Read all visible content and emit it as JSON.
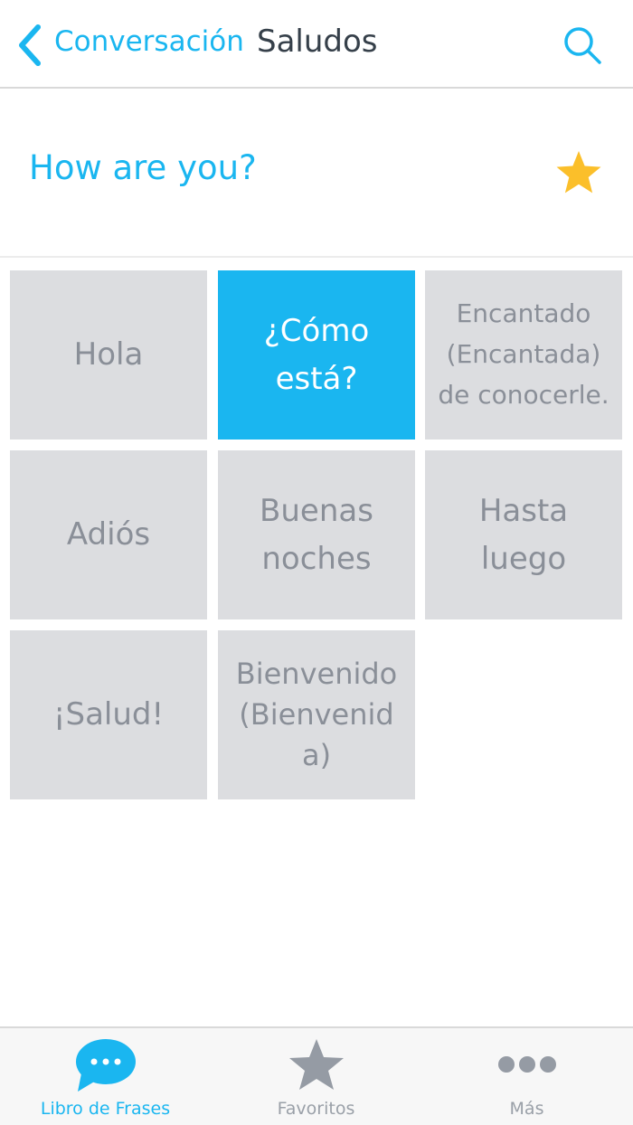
{
  "nav": {
    "back_label": "Conversación",
    "title": "Saludos"
  },
  "phrase": {
    "text": "How are you?",
    "favorited": true
  },
  "tiles": [
    {
      "label": "Hola",
      "selected": false
    },
    {
      "label": "¿Cómo\nestá?",
      "selected": true
    },
    {
      "label": "Encantado\n(Encantada)\nde conocerle.",
      "selected": false
    },
    {
      "label": "Adiós",
      "selected": false
    },
    {
      "label": "Buenas\nnoches",
      "selected": false
    },
    {
      "label": "Hasta\nluego",
      "selected": false
    },
    {
      "label": "¡Salud!",
      "selected": false
    },
    {
      "label": "Bienvenido\n(Bienvenid\na)",
      "selected": false
    }
  ],
  "tabbar": {
    "items": [
      {
        "label": "Libro de Frases",
        "icon": "chat-bubble-icon",
        "active": true
      },
      {
        "label": "Favoritos",
        "icon": "star-icon",
        "active": false
      },
      {
        "label": "Más",
        "icon": "more-dots-icon",
        "active": false
      }
    ]
  },
  "colors": {
    "accent": "#1ab6f0",
    "tile_bg": "#dcdde0",
    "tile_text": "#8a8f98",
    "star": "#fbbf2a",
    "title_text": "#36404a"
  }
}
